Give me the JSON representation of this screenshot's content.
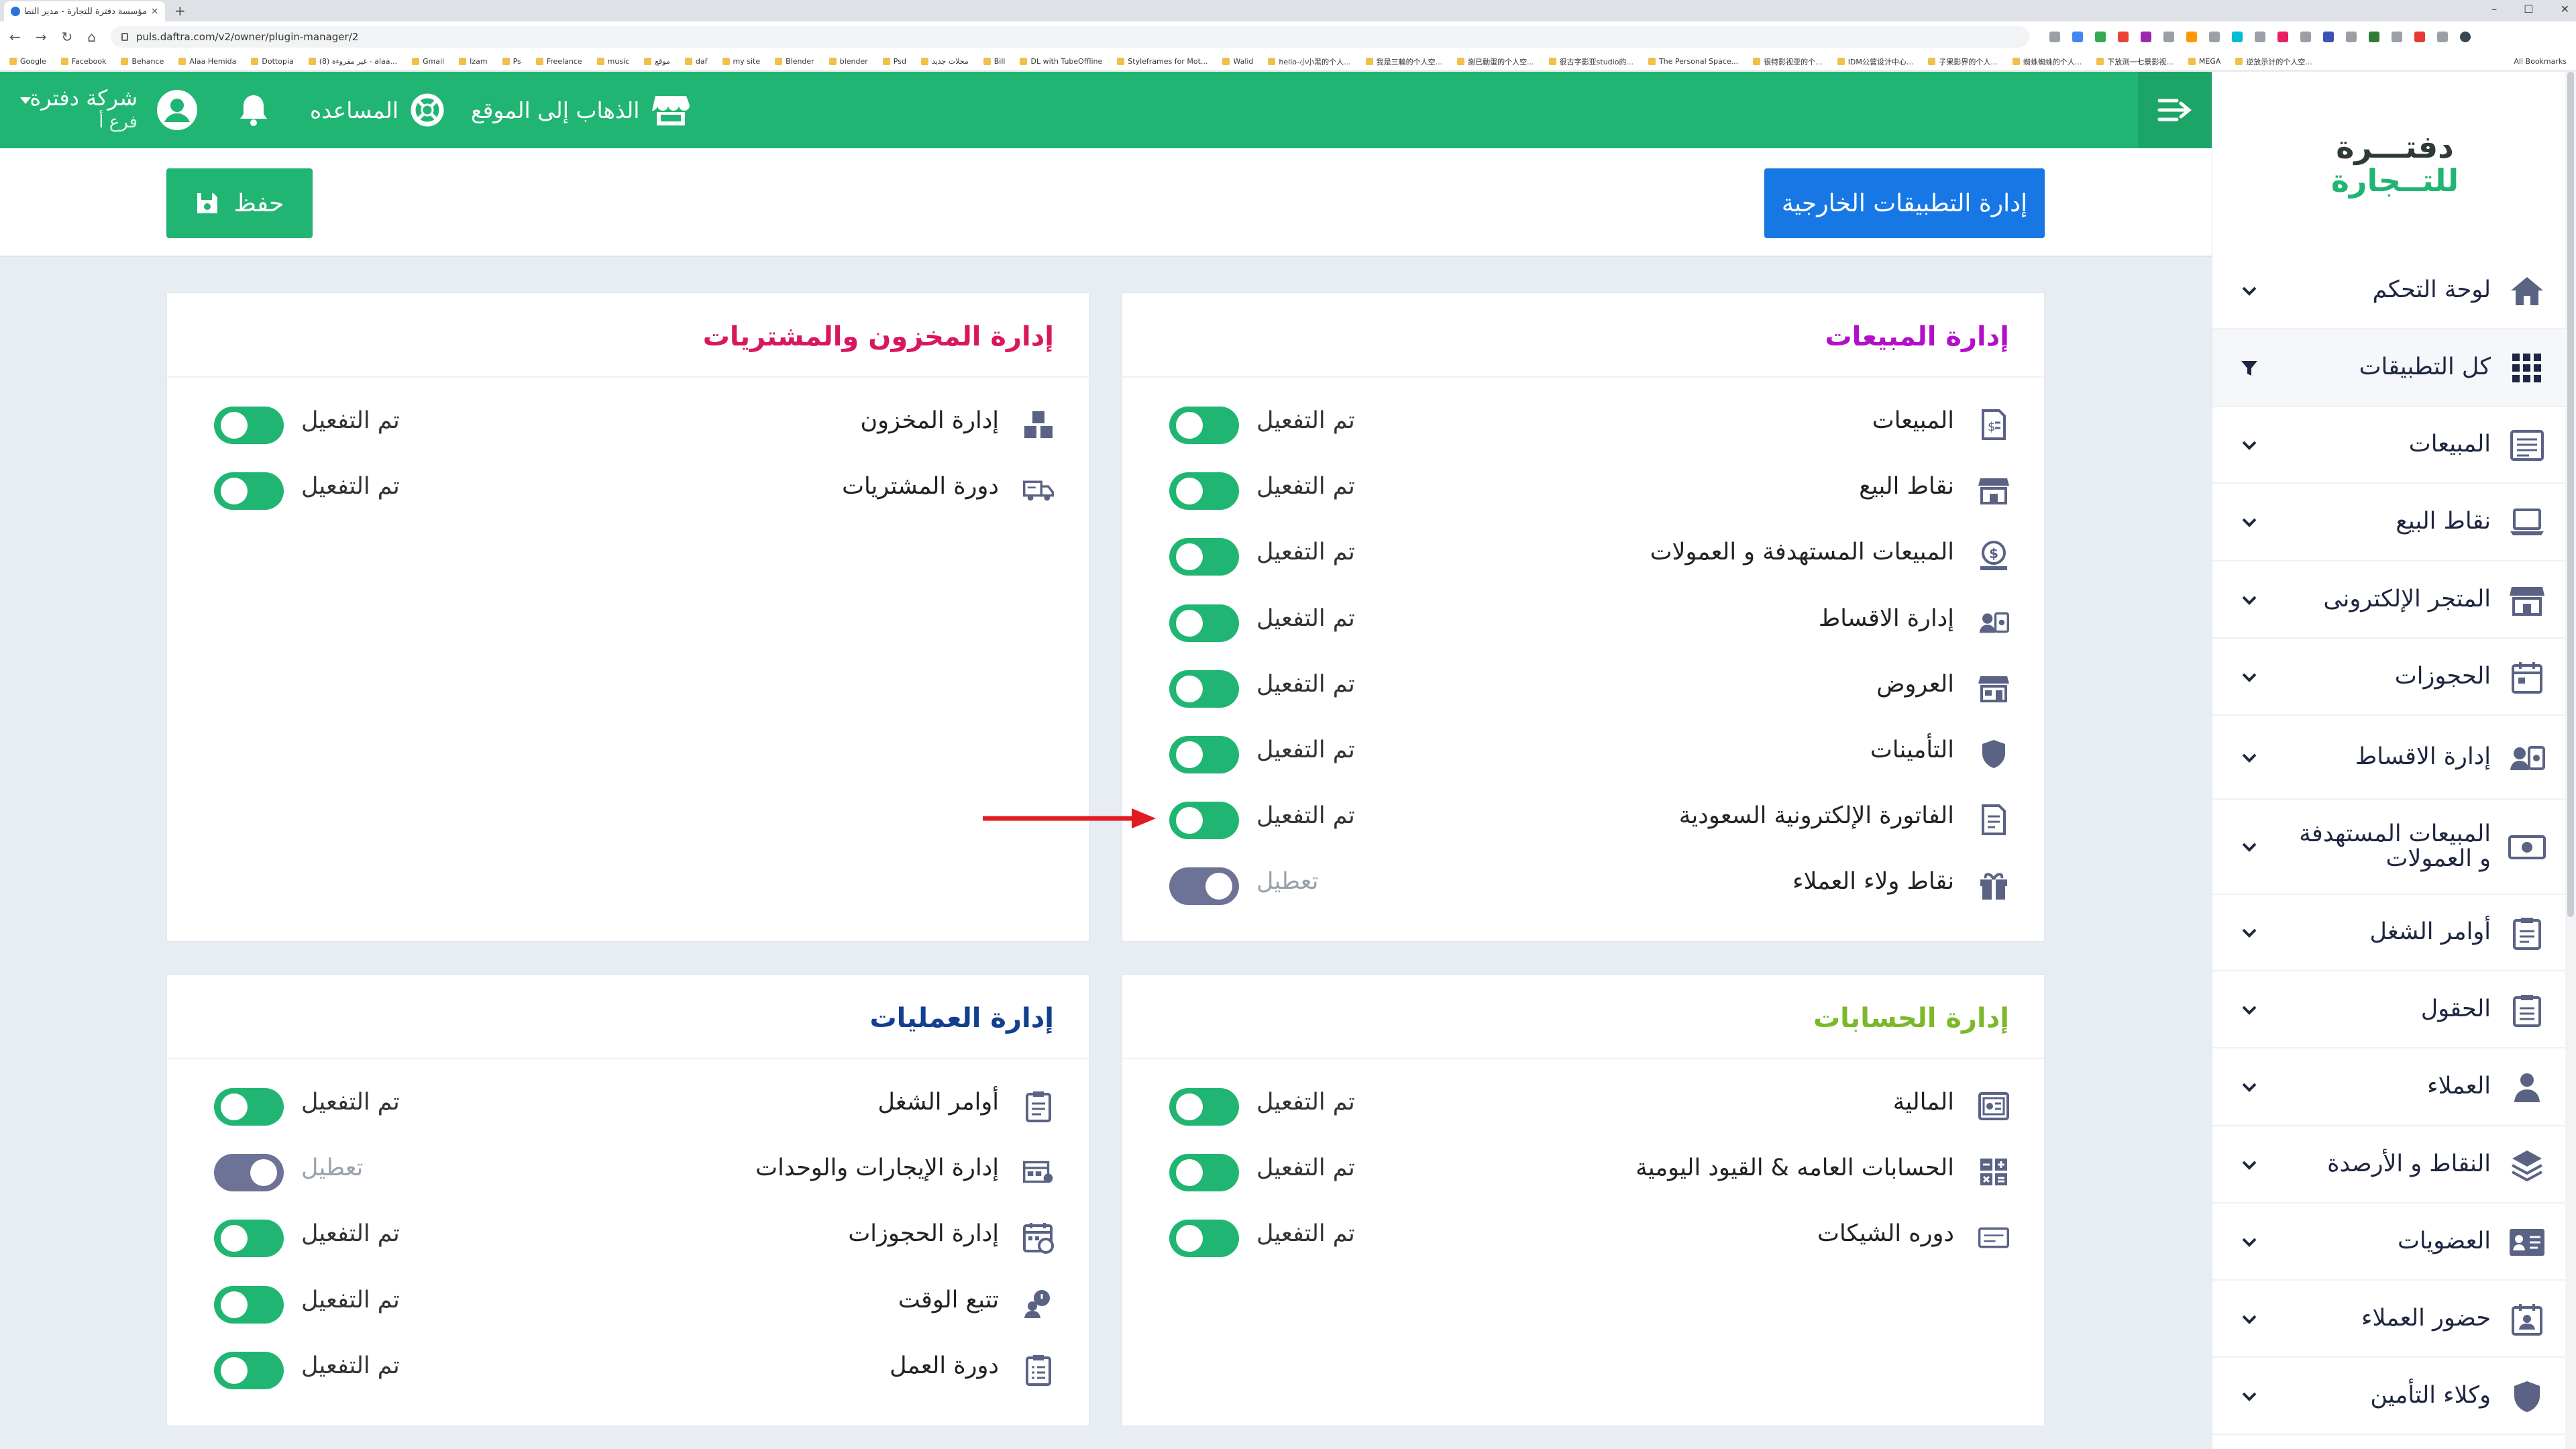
{
  "browser": {
    "tab_title": "مؤسسة دفترة للتجارة - مدير التط...",
    "new_tab": "+",
    "url": "puls.daftra.com/v2/owner/plugin-manager/2",
    "window_controls": [
      "–",
      "☐",
      "✕"
    ],
    "bookmarks": [
      "Google",
      "Facebook",
      "Behance",
      "Alaa Hemida",
      "Dottopia",
      "(8) غير مقروءة - alaa...",
      "Gmail",
      "Izam",
      "Ps",
      "Freelance",
      "music",
      "موقع",
      "daf",
      "my site",
      "Blender",
      "blender",
      "Psd",
      "محلات جديد",
      "Bill",
      "DL with TubeOffline",
      "Styleframes for Mot...",
      "Walid",
      "hello-小小黑的个人...",
      "我是三輪的个人空...",
      "謝已動蛋的个人空...",
      "很古字影亚studio的...",
      "The Personal Space...",
      "很特影视亚的个...",
      "IDM公营设计中心...",
      "子果影界的个人...",
      "蜘蛛蜘蛛的个人...",
      "下放测一七景影视...",
      "MEGA",
      "逆放示计的个人空..."
    ],
    "all_bookmarks": "All Bookmarks"
  },
  "header": {
    "company_name": "شركة دفترة",
    "branch": "فرع أ",
    "help": "المساعده",
    "go_to_site": "الذهاب إلى الموقع"
  },
  "toolbar": {
    "external_apps": "إدارة التطبيقات الخارجية",
    "save": "حفظ"
  },
  "colors": {
    "brand_green": "#21b573",
    "primary_blue": "#1677e5",
    "toggle_off": "#6d7396",
    "sales_title": "#b30fc8",
    "inventory_title": "#d8185e",
    "accounts_title": "#7cb92a",
    "operations_title": "#123f8f",
    "arrow": "#e21b22"
  },
  "panels": {
    "sales": {
      "title": "إدارة المبيعات",
      "rows": [
        {
          "label": "المبيعات",
          "status": "تم التفعيل",
          "enabled": true,
          "icon": "invoice-icon"
        },
        {
          "label": "نقاط البيع",
          "status": "تم التفعيل",
          "enabled": true,
          "icon": "store-icon"
        },
        {
          "label": "المبيعات المستهدفة و العمولات",
          "status": "تم التفعيل",
          "enabled": true,
          "icon": "dollar-badge-icon"
        },
        {
          "label": "إدارة الاقساط",
          "status": "تم التفعيل",
          "enabled": true,
          "icon": "installments-icon"
        },
        {
          "label": "العروض",
          "status": "تم التفعيل",
          "enabled": true,
          "icon": "offers-store-icon"
        },
        {
          "label": "التأمينات",
          "status": "تم التفعيل",
          "enabled": true,
          "icon": "shield-icon"
        },
        {
          "label": "الفاتورة الإلكترونية السعودية",
          "status": "تم التفعيل",
          "enabled": true,
          "icon": "e-invoice-icon"
        },
        {
          "label": "نقاط ولاء العملاء",
          "status": "تعطيل",
          "enabled": false,
          "icon": "gift-icon"
        }
      ]
    },
    "inventory": {
      "title": "إدارة المخزون والمشتريات",
      "rows": [
        {
          "label": "إدارة المخزون",
          "status": "تم التفعيل",
          "enabled": true,
          "icon": "boxes-icon"
        },
        {
          "label": "دورة المشتريات",
          "status": "تم التفعيل",
          "enabled": true,
          "icon": "truck-icon"
        }
      ]
    },
    "accounts": {
      "title": "إدارة الحسابات",
      "rows": [
        {
          "label": "المالية",
          "status": "تم التفعيل",
          "enabled": true,
          "icon": "finance-icon"
        },
        {
          "label": "الحسابات العامه & القيود اليومية",
          "status": "تم التفعيل",
          "enabled": true,
          "icon": "ledger-grid-icon"
        },
        {
          "label": "دوره الشيكات",
          "status": "تم التفعيل",
          "enabled": true,
          "icon": "cheque-icon"
        }
      ]
    },
    "operations": {
      "title": "إدارة العمليات",
      "rows": [
        {
          "label": "أوامر الشغل",
          "status": "تم التفعيل",
          "enabled": true,
          "icon": "clipboard-icon"
        },
        {
          "label": "إدارة الإيجارات والوحدات",
          "status": "تعطيل",
          "enabled": false,
          "icon": "rentals-icon"
        },
        {
          "label": "إدارة الحجوزات",
          "status": "تم التفعيل",
          "enabled": true,
          "icon": "calendar-clock-icon"
        },
        {
          "label": "تتبع الوقت",
          "status": "تم التفعيل",
          "enabled": true,
          "icon": "time-tracking-icon"
        },
        {
          "label": "دورة العمل",
          "status": "تم التفعيل",
          "enabled": true,
          "icon": "workflow-clipboard-icon"
        }
      ]
    }
  },
  "sidebar": {
    "logo_text": [
      "دفتـــرة",
      "للتــجارة"
    ],
    "items": [
      {
        "label": "لوحة التحكم",
        "icon": "home-icon"
      },
      {
        "label": "كل التطبيقات",
        "icon": "apps-grid-icon"
      },
      {
        "label": "المبيعات",
        "icon": "sales-doc-icon"
      },
      {
        "label": "نقاط البيع",
        "icon": "laptop-icon"
      },
      {
        "label": "المتجر الإلكترونى",
        "icon": "shop-icon"
      },
      {
        "label": "الحجوزات",
        "icon": "calendar-icon"
      },
      {
        "label": "إدارة الاقساط",
        "icon": "installments-icon"
      },
      {
        "label": "المبيعات المستهدفة و العمولات",
        "icon": "money-icon"
      },
      {
        "label": "أوامر الشغل",
        "icon": "work-orders-icon"
      },
      {
        "label": "الحقول",
        "icon": "fields-icon"
      },
      {
        "label": "العملاء",
        "icon": "customers-icon"
      },
      {
        "label": "النقاط و الأرصدة",
        "icon": "layers-icon"
      },
      {
        "label": "العضويات",
        "icon": "membership-card-icon"
      },
      {
        "label": "حضور العملاء",
        "icon": "attendance-icon"
      },
      {
        "label": "وكلاء التأمين",
        "icon": "insurance-agents-icon"
      }
    ]
  }
}
